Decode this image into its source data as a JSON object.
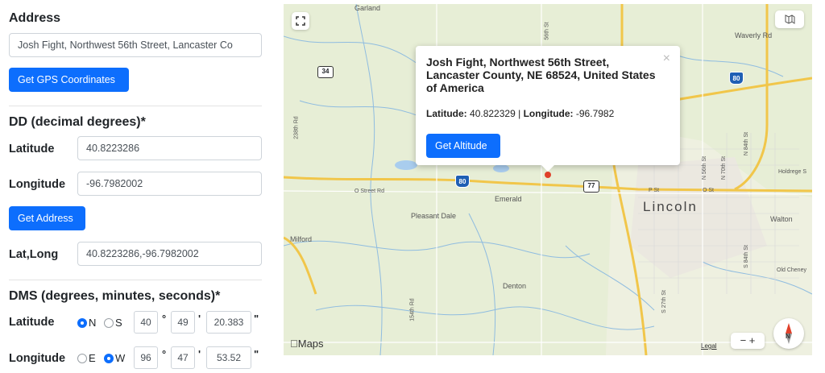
{
  "address": {
    "heading": "Address",
    "input_value": "Josh Fight, Northwest 56th Street, Lancaster Co",
    "button": "Get GPS Coordinates"
  },
  "dd": {
    "heading": "DD (decimal degrees)*",
    "latitude_label": "Latitude",
    "latitude_value": "40.8223286",
    "longitude_label": "Longitude",
    "longitude_value": "-96.7982002",
    "button": "Get Address",
    "latlong_label": "Lat,Long",
    "latlong_value": "40.8223286,-96.7982002"
  },
  "dms": {
    "heading": "DMS (degrees, minutes, seconds)*",
    "latitude_label": "Latitude",
    "lat_n": "N",
    "lat_s": "S",
    "lat_deg": "40",
    "lat_min": "49",
    "lat_sec": "20.383",
    "longitude_label": "Longitude",
    "lon_e": "E",
    "lon_w": "W",
    "lon_deg": "96",
    "lon_min": "47",
    "lon_sec": "53.52",
    "deg_symbol": "°",
    "min_symbol": "'",
    "sec_symbol": "\""
  },
  "map": {
    "popup_title": "Josh Fight, Northwest 56th Street, Lancaster County, NE 68524, United States of America",
    "popup_lat_label": "Latitude:",
    "popup_lat_value": "40.822329",
    "popup_sep": "|",
    "popup_lon_label": "Longitude:",
    "popup_lon_value": "-96.7982",
    "popup_button": "Get Altitude",
    "close": "×",
    "labels": {
      "garland": "Garland",
      "waverly": "Waverly Rd",
      "lincoln": "Lincoln",
      "emerald": "Emerald",
      "pleasant_dale": "Pleasant Dale",
      "milford": "Milford",
      "denton": "Denton",
      "walton": "Walton",
      "o_street": "O Street Rd",
      "p_st": "P St",
      "o_st": "O St",
      "old_cheney": "Old Cheney",
      "holdrege": "Holdrege S",
      "r56": "56th St",
      "r238": "238th Rd",
      "r154": "154th Rd",
      "r27": "S 27th St",
      "n56": "N 56th St",
      "n70": "N 70th St",
      "n84": "N 84th St",
      "s84": "S 84th St",
      "hwy34": "34",
      "hwy80a": "80",
      "hwy80b": "80",
      "hwy77": "77",
      "apple_maps": "Maps",
      "legal": "Legal",
      "zoom": "−  +",
      "compass_n": "N"
    }
  }
}
